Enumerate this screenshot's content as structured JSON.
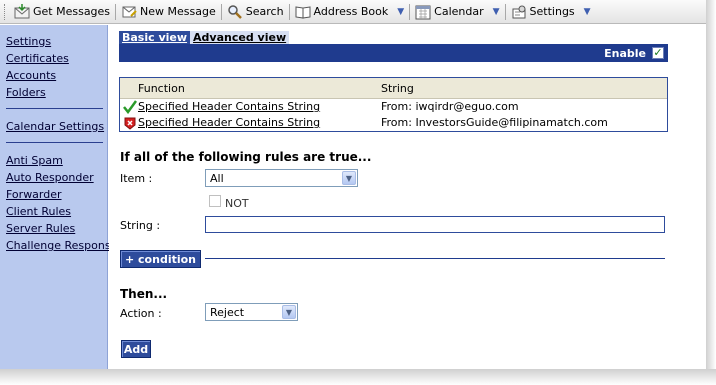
{
  "toolbar": {
    "get_messages": "Get Messages",
    "new_message": "New Message",
    "search": "Search",
    "address_book": "Address Book",
    "calendar": "Calendar",
    "settings": "Settings",
    "dropdown_arrow": "▼"
  },
  "sidebar": {
    "group1": [
      "Settings",
      "Certificates",
      "Accounts",
      "Folders"
    ],
    "group2": [
      "Calendar Settings"
    ],
    "group3": [
      "Anti Spam",
      "Auto Responder",
      "Forwarder",
      "Client Rules",
      "Server Rules",
      "Challenge Response"
    ]
  },
  "tabs": {
    "basic": "Basic view",
    "advanced": "Advanced view"
  },
  "enable": {
    "label": "Enable",
    "checked": true
  },
  "rules": {
    "headers": {
      "function": "Function",
      "string": "String"
    },
    "rows": [
      {
        "status": "allow",
        "function": "Specified Header Contains String",
        "string": "From: iwqirdr@eguo.com"
      },
      {
        "status": "block",
        "function": "Specified Header Contains String",
        "string": "From: InvestorsGuide@filipinamatch.com"
      }
    ]
  },
  "conditions": {
    "title": "If all of the following rules are true...",
    "item_label": "Item :",
    "item_value": "All",
    "not_label": "NOT",
    "string_label": "String :",
    "string_value": "",
    "add_condition": "+ condition"
  },
  "then": {
    "title": "Then...",
    "action_label": "Action :",
    "action_value": "Reject",
    "add_button": "Add"
  },
  "colors": {
    "accent": "#1f3b8e",
    "sidebar_bg": "#b9c9ee"
  }
}
